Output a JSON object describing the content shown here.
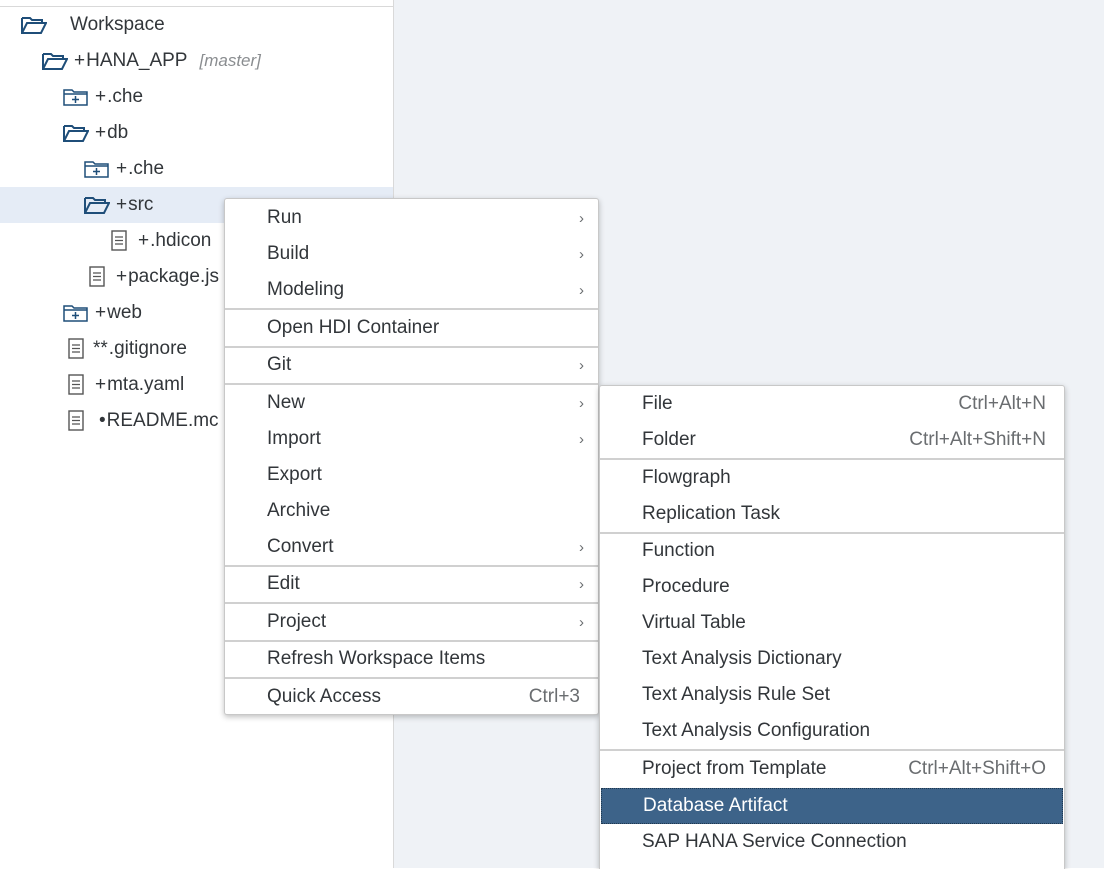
{
  "tree": {
    "items": [
      {
        "prefix": "",
        "label": "Workspace",
        "branch": "",
        "icon": "folder-open-icon"
      },
      {
        "prefix": "+",
        "label": "HANA_APP",
        "branch": "[master]",
        "icon": "folder-open-icon"
      },
      {
        "prefix": "+",
        "label": ".che",
        "branch": "",
        "icon": "folder-plus-icon"
      },
      {
        "prefix": "+",
        "label": "db",
        "branch": "",
        "icon": "folder-open-icon"
      },
      {
        "prefix": "+",
        "label": ".che",
        "branch": "",
        "icon": "folder-plus-icon"
      },
      {
        "prefix": "+",
        "label": "src",
        "branch": "",
        "icon": "folder-open-icon"
      },
      {
        "prefix": "+",
        "label": ".hdicon",
        "branch": "",
        "icon": "document-icon"
      },
      {
        "prefix": "+",
        "label": "package.js",
        "branch": "",
        "icon": "document-icon"
      },
      {
        "prefix": "+",
        "label": "web",
        "branch": "",
        "icon": "folder-plus-icon"
      },
      {
        "prefix": "**",
        "label": ".gitignore",
        "branch": "",
        "icon": "document-icon"
      },
      {
        "prefix": "+",
        "label": "mta.yaml",
        "branch": "",
        "icon": "document-icon"
      },
      {
        "prefix": "•",
        "label": "README.mc",
        "branch": "",
        "icon": "document-icon"
      }
    ]
  },
  "context_menu": {
    "items": [
      {
        "label": "Run",
        "arrow": "›"
      },
      {
        "label": "Build",
        "arrow": "›"
      },
      {
        "label": "Modeling",
        "arrow": "›"
      },
      {
        "label": "Open HDI Container"
      },
      {
        "label": "Git",
        "arrow": "›"
      },
      {
        "label": "New",
        "arrow": "›"
      },
      {
        "label": "Import",
        "arrow": "›"
      },
      {
        "label": "Export"
      },
      {
        "label": "Archive"
      },
      {
        "label": "Convert",
        "arrow": "›"
      },
      {
        "label": "Edit",
        "arrow": "›"
      },
      {
        "label": "Project",
        "arrow": "›"
      },
      {
        "label": "Refresh Workspace Items"
      },
      {
        "label": "Quick Access",
        "shortcut": "Ctrl+3"
      }
    ]
  },
  "new_submenu": {
    "items": [
      {
        "label": "File",
        "shortcut": "Ctrl+Alt+N"
      },
      {
        "label": "Folder",
        "shortcut": "Ctrl+Alt+Shift+N"
      },
      {
        "label": "Flowgraph"
      },
      {
        "label": "Replication Task"
      },
      {
        "label": "Function"
      },
      {
        "label": "Procedure"
      },
      {
        "label": "Virtual Table"
      },
      {
        "label": "Text Analysis Dictionary"
      },
      {
        "label": "Text Analysis Rule Set"
      },
      {
        "label": "Text Analysis Configuration"
      },
      {
        "label": "Project from Template",
        "shortcut": "Ctrl+Alt+Shift+O"
      },
      {
        "label": "Database Artifact"
      },
      {
        "label": "SAP HANA Service Connection"
      }
    ]
  },
  "colors": {
    "folder_icon": "#1f4e79",
    "selected_row": "#e5ecf6",
    "highlight": "#3d6389",
    "editor_bg": "#eff2f6"
  }
}
